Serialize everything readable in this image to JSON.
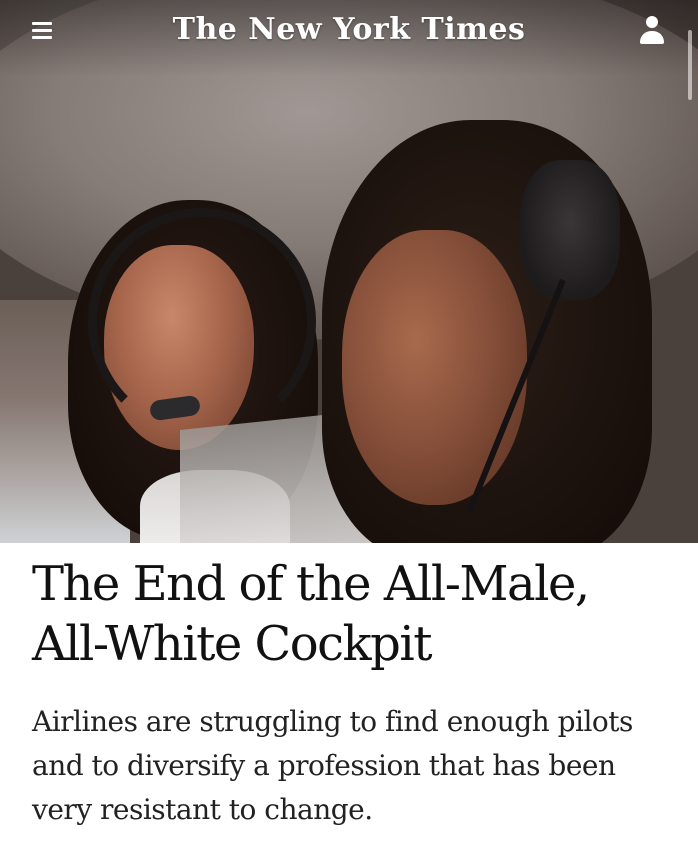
{
  "header": {
    "masthead": "The New York Times",
    "menu_icon": "hamburger-menu-icon",
    "account_icon": "account-icon"
  },
  "hero": {
    "image": "photo of two pilots in a cockpit wearing headsets"
  },
  "article": {
    "headline": "The End of the All-Male, All-White Cockpit",
    "summary": "Airlines are struggling to find enough pilots and to diversify a profession that has been very resistant to change."
  },
  "colors": {
    "header_text": "#ffffff",
    "headline_text": "#111111",
    "summary_text": "#222222",
    "background": "#ffffff"
  }
}
